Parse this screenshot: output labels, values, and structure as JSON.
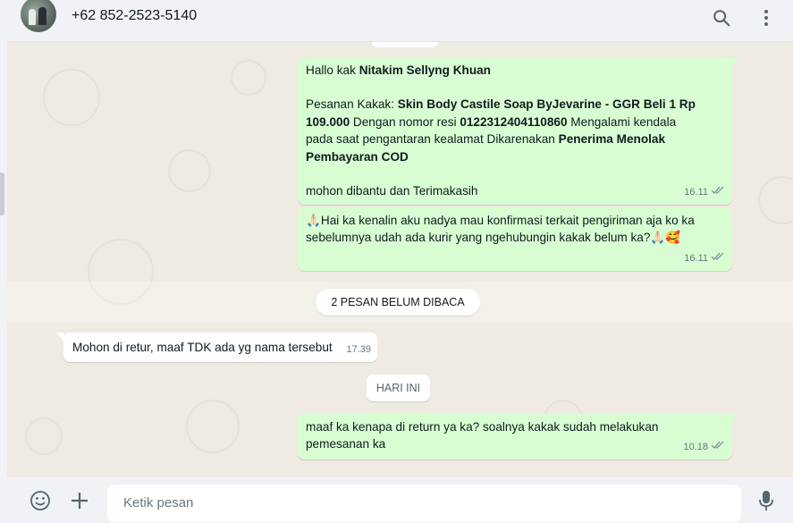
{
  "header": {
    "contact_name": "+62 852-2523-5140",
    "icons": [
      "avatar",
      "search-icon",
      "menu-icon"
    ]
  },
  "messages": [
    {
      "direction": "outgoing",
      "greeting_prefix": "Hallo kak ",
      "greeting_name": "Nitakim Sellyng Khuan",
      "order_prefix": "Pesanan Kakak: ",
      "order_product": "Skin Body Castile Soap ByJevarine - GGR Beli 1 Rp 109.000",
      "resi_prefix": " Dengan nomor resi ",
      "resi_number": "0122312404110860",
      "problem_text": " Mengalami kendala pada saat pengantaran kealamat Dikarenakan ",
      "problem_reason": "Penerima Menolak Pembayaran COD",
      "closing": " mohon dibantu dan Terimakasih",
      "time": "16.11",
      "status": "delivered"
    },
    {
      "direction": "outgoing",
      "text": "🙏🏻Hai ka kenalin aku nadya mau konfirmasi terkait pengiriman aja ko ka sebelumnya udah ada kurir yang ngehubungin kakak belum ka?🙏🏻🥰",
      "time": "16.11",
      "status": "delivered"
    },
    {
      "direction": "incoming",
      "text": "Mohon di retur, maaf TDK ada yg nama tersebut",
      "time": "17.39"
    },
    {
      "direction": "outgoing",
      "text": "maaf ka kenapa di return ya ka? soalnya kakak sudah melakukan pemesanan ka",
      "time": "10.18",
      "status": "delivered"
    }
  ],
  "unread_label": "2 PESAN BELUM DIBACA",
  "date_label": "HARI INI",
  "composer": {
    "placeholder": "Ketik pesan",
    "icons": [
      "emoji-icon",
      "plus-icon",
      "mic-icon"
    ]
  },
  "colors": {
    "outgoing_bubble": "#d9fdd3",
    "incoming_bubble": "#ffffff",
    "chat_background": "#efeae2",
    "panel_background": "#f0f2f5",
    "read_tick": "#8696a0"
  }
}
